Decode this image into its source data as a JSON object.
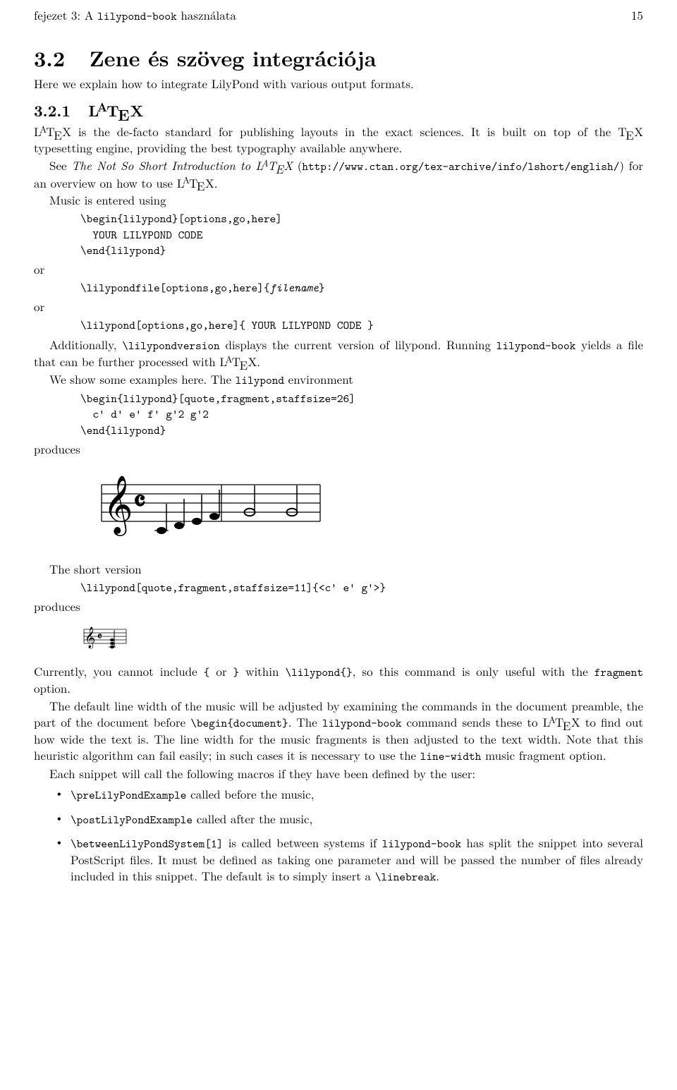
{
  "header": {
    "left_prefix": "fejezet 3: A ",
    "left_tt": "lilypond-book",
    "left_suffix": " használata",
    "page_number": "15"
  },
  "section": {
    "number": "3.2",
    "title": "Zene és szöveg integrációja",
    "intro": "Here we explain how to integrate LilyPond with various output formats."
  },
  "subsection": {
    "number": "3.2.1"
  },
  "p1": {
    "t1": " is the de-facto standard for publishing layouts in the exact sciences. It is built on top of the ",
    "t2": " typesetting engine, providing the best typography available anywhere."
  },
  "p2": {
    "t1": "See ",
    "it": "The Not So Short Introduction to ",
    "t2": " (",
    "url": "http://www.ctan.org/tex-archive/info/lshort/english/",
    "t3": ") for an overview on how to use ",
    "t4": "."
  },
  "p3": "Music is entered using",
  "code1": "\\begin{lilypond}[options,go,here]\n  YOUR LILYPOND CODE\n\\end{lilypond}",
  "or": "or",
  "code2": "\\lilypondfile[options,go,here]{",
  "code2_it": "filename",
  "code2_end": "}",
  "code3": "\\lilypond[options,go,here]{ YOUR LILYPOND CODE }",
  "p4": {
    "t1": "Additionally, ",
    "tt1": "\\lilypondversion",
    "t2": " displays the current version of lilypond. Running ",
    "tt2": "lilypond-book",
    "t3": " yields a file that can be further processed with ",
    "t4": "."
  },
  "p5": {
    "t1": "We show some examples here. The ",
    "tt1": "lilypond",
    "t2": " environment"
  },
  "code4": "\\begin{lilypond}[quote,fragment,staffsize=26]\n  c' d' e' f' g'2 g'2\n\\end{lilypond}",
  "produces": "produces",
  "p6": "The short version",
  "code5": "\\lilypond[quote,fragment,staffsize=11]{<c' e' g'>}",
  "p7": {
    "t1": "Currently, you cannot include ",
    "tt1": "{",
    "t2": " or ",
    "tt2": "}",
    "t3": " within ",
    "tt3": "\\lilypond{}",
    "t4": ", so this command is only useful with the ",
    "tt4": "fragment",
    "t5": " option."
  },
  "p8": {
    "t1": "The default line width of the music will be adjusted by examining the commands in the document preamble, the part of the document before ",
    "tt1": "\\begin{document}",
    "t2": ". The ",
    "tt2": "lilypond-book",
    "t3": " command sends these to ",
    "t4": " to find out how wide the text is. The line width for the music fragments is then adjusted to the text width. Note that this heuristic algorithm can fail easily; in such cases it is necessary to use the ",
    "tt3": "line-width",
    "t5": " music fragment option."
  },
  "p9": "Each snippet will call the following macros if they have been defined by the user:",
  "bullets": [
    {
      "tt": "\\preLilyPondExample",
      "rest": " called before the music,"
    },
    {
      "tt": "\\postLilyPondExample",
      "rest": " called after the music,"
    },
    {
      "tt": "\\betweenLilyPondSystem[1]",
      "rest_a": " is called between systems if ",
      "tt2": "lilypond-book",
      "rest_b": " has split the snippet into several PostScript files. It must be defined as taking one parameter and will be passed the number of files already included in this snippet. The default is to simply insert a ",
      "tt3": "\\linebreak",
      "rest_c": "."
    }
  ],
  "chart_data": [
    {
      "type": "music-staff",
      "description": "LilyPond large staff output",
      "clef": "treble",
      "time_signature": "C",
      "staffsize": 26,
      "notes": [
        "c'4",
        "d'4",
        "e'4",
        "f'4",
        "g'2",
        "g'2"
      ]
    },
    {
      "type": "music-staff",
      "description": "LilyPond small chord output",
      "clef": "treble",
      "time_signature": "C",
      "staffsize": 11,
      "notes": [
        "<c' e' g'>"
      ]
    }
  ]
}
